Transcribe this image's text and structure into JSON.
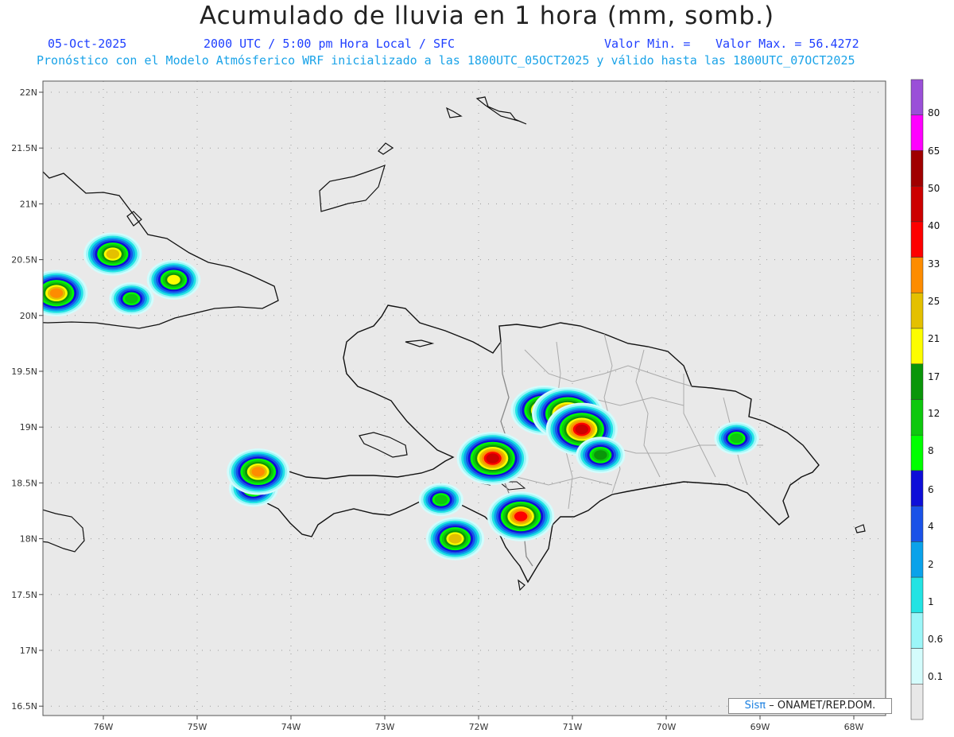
{
  "header": {
    "title": "Acumulado de lluvia en 1 hora (mm, somb.)",
    "date": "05-Oct-2025",
    "time": "2000 UTC / 5:00 pm Hora Local / SFC",
    "min_label": "Valor Min. =",
    "max_label": "Valor Max. = 56.4272",
    "description": "Pronóstico con el Modelo Atmósferico WRF inicializado a las 1800UTC_05OCT2025 y válido hasta las  1800UTC_07OCT2025"
  },
  "map": {
    "lat_labels": [
      "22N",
      "21.5N",
      "21N",
      "20.5N",
      "20N",
      "19.5N",
      "19N",
      "18.5N",
      "18N",
      "17.5N",
      "17N",
      "16.5N"
    ],
    "lon_labels": [
      "76W",
      "75W",
      "74W",
      "73W",
      "72W",
      "71W",
      "70W",
      "69W",
      "68W"
    ],
    "colors": {
      "land": "#e9e9e9",
      "coast": "#111111",
      "borders": "#a8a8a8",
      "grid": "#9a9a9a"
    },
    "rain_cells": [
      {
        "lon": -75.9,
        "lat": 20.55,
        "max_mm": 25
      },
      {
        "lon": -76.5,
        "lat": 20.2,
        "max_mm": 33
      },
      {
        "lon": -75.7,
        "lat": 20.15,
        "max_mm": 12
      },
      {
        "lon": -75.25,
        "lat": 20.32,
        "max_mm": 21
      },
      {
        "lon": -74.4,
        "lat": 18.45,
        "max_mm": 17
      },
      {
        "lon": -74.35,
        "lat": 18.6,
        "max_mm": 33
      },
      {
        "lon": -71.3,
        "lat": 19.15,
        "max_mm": 40
      },
      {
        "lon": -71.05,
        "lat": 19.12,
        "max_mm": 50
      },
      {
        "lon": -70.9,
        "lat": 18.98,
        "max_mm": 50
      },
      {
        "lon": -70.7,
        "lat": 18.75,
        "max_mm": 17
      },
      {
        "lon": -71.85,
        "lat": 18.72,
        "max_mm": 50
      },
      {
        "lon": -71.55,
        "lat": 18.2,
        "max_mm": 40
      },
      {
        "lon": -72.25,
        "lat": 18.0,
        "max_mm": 25
      },
      {
        "lon": -72.4,
        "lat": 18.35,
        "max_mm": 12
      },
      {
        "lon": -69.25,
        "lat": 18.9,
        "max_mm": 12
      }
    ]
  },
  "colorbar": {
    "labels": [
      "0.1",
      "0.6",
      "1",
      "2",
      "4",
      "6",
      "8",
      "12",
      "17",
      "21",
      "25",
      "33",
      "40",
      "50",
      "65",
      "80"
    ],
    "colors": [
      "#e8e8e8",
      "#d4fcfc",
      "#9cf6f8",
      "#23e3e3",
      "#0aa2ea",
      "#1a52e8",
      "#0e0ed8",
      "#00ff00",
      "#0ec80e",
      "#0a960a",
      "#fdfd00",
      "#e4c000",
      "#fe8c00",
      "#fd0000",
      "#cc0000",
      "#a00000",
      "#ff00ff",
      "#9a4fd8"
    ]
  },
  "credit": {
    "logo": "Sisπ",
    "text": "– ONAMET/REP.DOM."
  }
}
